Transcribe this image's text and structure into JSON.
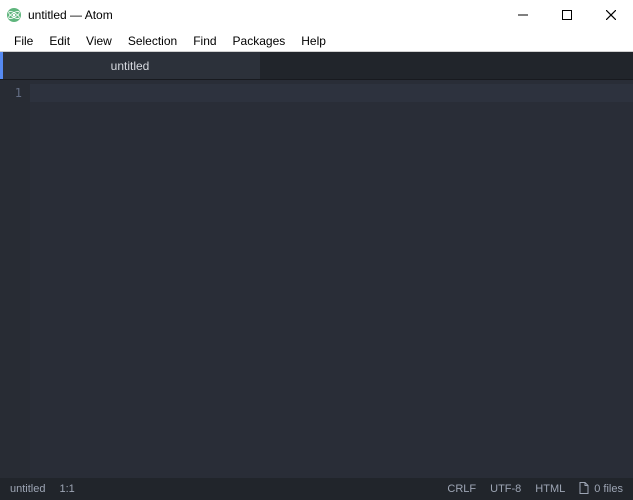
{
  "titlebar": {
    "title": "untitled — Atom"
  },
  "menu": {
    "file": "File",
    "edit": "Edit",
    "view": "View",
    "selection": "Selection",
    "find": "Find",
    "packages": "Packages",
    "help": "Help"
  },
  "tabs": [
    {
      "label": "untitled",
      "active": true
    }
  ],
  "editor": {
    "line_numbers": [
      "1"
    ]
  },
  "status": {
    "filename": "untitled",
    "cursor": "1:1",
    "line_ending": "CRLF",
    "encoding": "UTF-8",
    "grammar": "HTML",
    "git_files": "0 files"
  }
}
